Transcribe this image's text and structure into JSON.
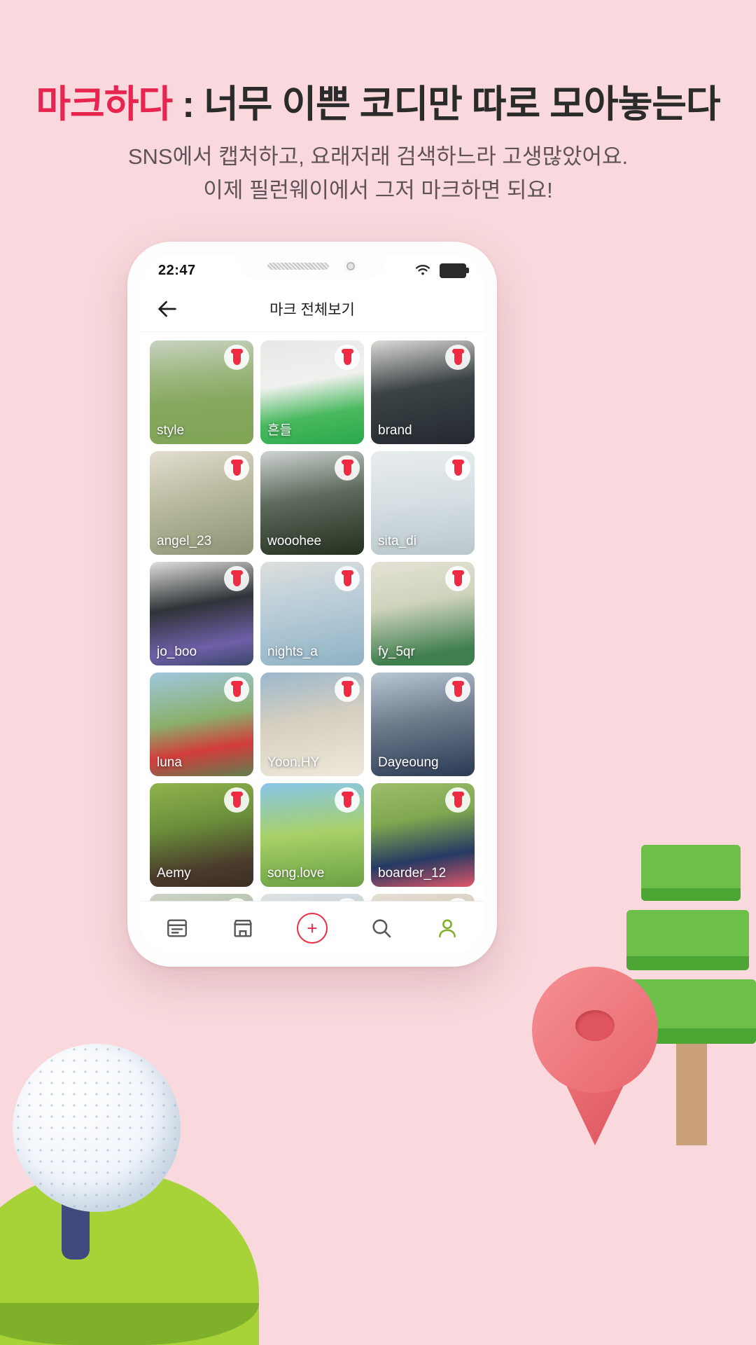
{
  "promo": {
    "headline_accent": "마크하다",
    "headline_rest": " : 너무 이쁜 코디만 따로 모아놓는다",
    "subtitle_line1": "SNS에서 캡처하고, 요래저래 검색하느라 고생많았어요.",
    "subtitle_line2": "이제 필런웨이에서 그저 마크하면 되요!",
    "accent_color": "#e8254f",
    "background_color": "#f9d9dd"
  },
  "phone": {
    "status": {
      "time": "22:47",
      "wifi_icon": "wifi-icon",
      "battery_icon": "battery-full-icon"
    },
    "appbar": {
      "back_icon": "back-arrow-icon",
      "title": "마크 전체보기"
    },
    "grid": {
      "cards": [
        {
          "label": "style",
          "photo": "p1"
        },
        {
          "label": "흔들",
          "photo": "p2"
        },
        {
          "label": "brand",
          "photo": "p3"
        },
        {
          "label": "angel_23",
          "photo": "p4"
        },
        {
          "label": "wooohee",
          "photo": "p5"
        },
        {
          "label": "sita_di",
          "photo": "p6"
        },
        {
          "label": "jo_boo",
          "photo": "p7"
        },
        {
          "label": "nights_a",
          "photo": "p8"
        },
        {
          "label": "fy_5qr",
          "photo": "p9"
        },
        {
          "label": "luna",
          "photo": "p10"
        },
        {
          "label": "Yoon.HY",
          "photo": "p11"
        },
        {
          "label": "Dayeoung",
          "photo": "p12"
        },
        {
          "label": "Aemy",
          "photo": "p13"
        },
        {
          "label": "song.love",
          "photo": "p14"
        },
        {
          "label": "boarder_12",
          "photo": "p15"
        },
        {
          "label": "",
          "photo": "p16"
        },
        {
          "label": "",
          "photo": "p17"
        },
        {
          "label": "",
          "photo": "p18"
        }
      ],
      "badge_icon": "golf-tee-mark-icon",
      "badge_color": "#ef2b43"
    },
    "tabbar": {
      "items": [
        {
          "icon": "feed-icon",
          "name": "tab-feed"
        },
        {
          "icon": "store-icon",
          "name": "tab-store"
        },
        {
          "icon": "plus-icon",
          "name": "tab-add",
          "label": "+"
        },
        {
          "icon": "search-icon",
          "name": "tab-search"
        },
        {
          "icon": "person-icon",
          "name": "tab-profile"
        }
      ],
      "add_color": "#ef2b43",
      "profile_color": "#7fb02a"
    }
  }
}
